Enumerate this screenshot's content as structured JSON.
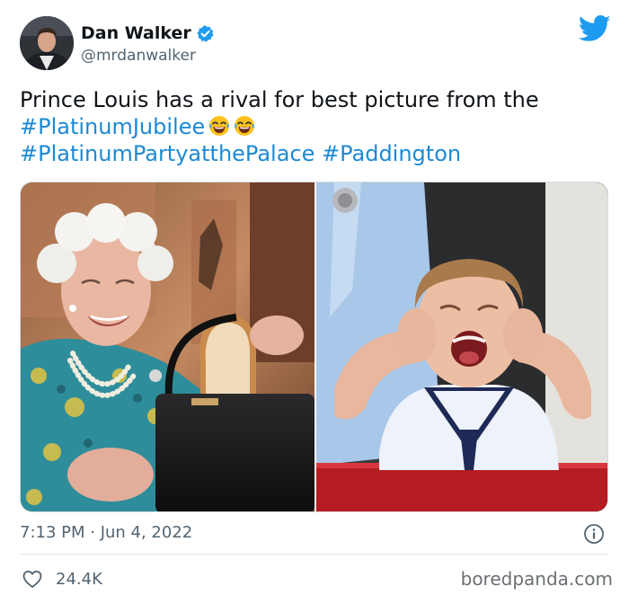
{
  "tweet": {
    "author": {
      "name": "Dan Walker",
      "handle": "@mrdanwalker",
      "verified": true
    },
    "text_line1": "Prince Louis has a rival for best picture from the",
    "hashtag_platinum_jubilee": "#PlatinumJubilee",
    "hashtag_party_palace": "#PlatinumPartyatthePalace",
    "hashtag_paddington": "#Paddington",
    "emoji": "face-with-tears-of-joy",
    "timestamp": "7:13 PM · Jun 4, 2022",
    "like_count": "24.4K"
  },
  "watermark": "boredpanda.com",
  "colors": {
    "hashtag": "#1d8ad4",
    "verified": "#1d9bf0",
    "twitter_blue": "#1d9bf0",
    "secondary_text": "#536471"
  },
  "icons": {
    "logo": "twitter-bird-icon",
    "badge": "verified-badge-icon",
    "info": "info-icon",
    "like": "heart-icon"
  }
}
